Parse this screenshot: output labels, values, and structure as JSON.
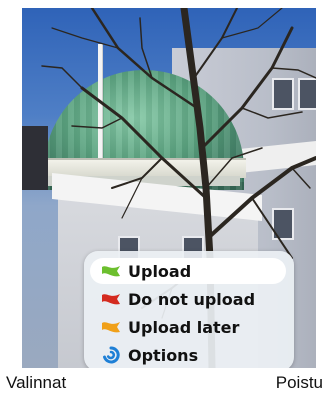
{
  "menu": {
    "items": [
      {
        "label": "Upload",
        "icon": "green-flag-icon",
        "color": "#6cbf2e",
        "selected": true
      },
      {
        "label": "Do not upload",
        "icon": "red-flag-icon",
        "color": "#d42a1f",
        "selected": false
      },
      {
        "label": "Upload later",
        "icon": "orange-flag-icon",
        "color": "#f0a019",
        "selected": false
      },
      {
        "label": "Options",
        "icon": "options-swirl-icon",
        "color": "#1e7fd6",
        "selected": false
      }
    ]
  },
  "softkeys": {
    "left": "Valinnat",
    "right": "Poistu"
  },
  "colors": {
    "menu_background": "#ebf0f4",
    "selection": "#ffffff"
  }
}
